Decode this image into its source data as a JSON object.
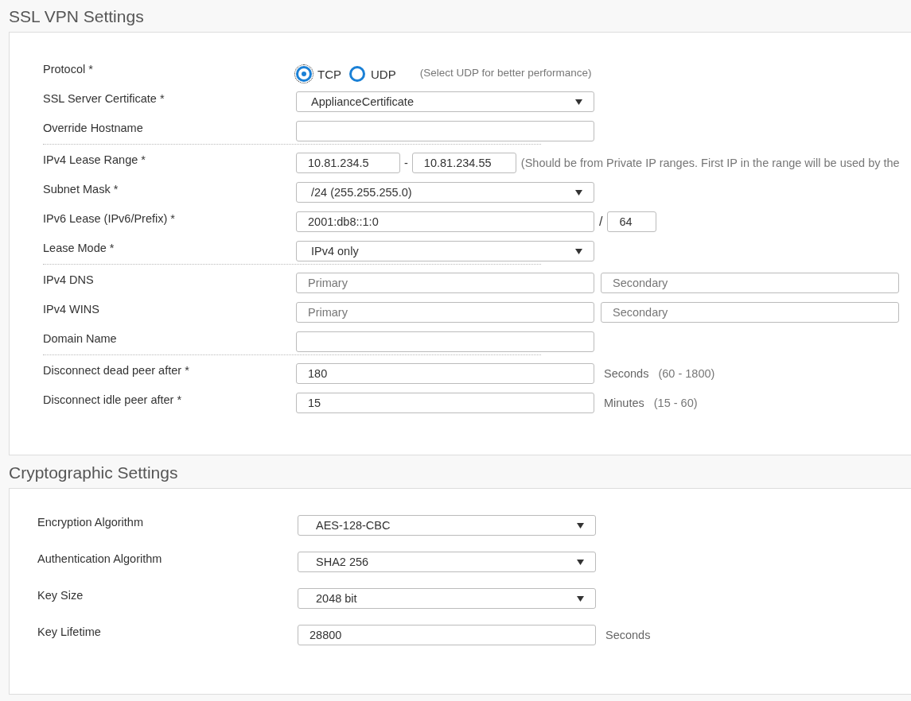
{
  "sections": [
    {
      "title": "SSL VPN Settings",
      "groups": [
        [
          {
            "kind": "radio",
            "label": "Protocol *",
            "options": [
              {
                "label": "TCP",
                "selected": true
              },
              {
                "label": "UDP",
                "selected": false
              }
            ],
            "hint": "(Select UDP for better performance)"
          },
          {
            "kind": "select",
            "label": "SSL Server Certificate *",
            "value": "ApplianceCertificate"
          },
          {
            "kind": "input",
            "label": "Override Hostname"
          }
        ],
        [
          {
            "kind": "range",
            "label": "IPv4 Lease Range *",
            "from": "10.81.234.5",
            "separator": "-",
            "to": "10.81.234.55",
            "hint": "(Should be from Private IP ranges. First IP in the range will be used by the"
          },
          {
            "kind": "select",
            "label": "Subnet Mask *",
            "value": "/24 (255.255.255.0)"
          },
          {
            "kind": "prefix",
            "label": "IPv6 Lease (IPv6/Prefix) *",
            "value": "2001:db8::1:0",
            "separator": "/",
            "prefix": "64"
          },
          {
            "kind": "select",
            "label": "Lease Mode *",
            "value": "IPv4 only"
          }
        ],
        [
          {
            "kind": "pair",
            "label": "IPv4 DNS",
            "fields": [
              {
                "placeholder": "Primary"
              },
              {
                "placeholder": "Secondary"
              }
            ]
          },
          {
            "kind": "pair",
            "label": "IPv4 WINS",
            "fields": [
              {
                "placeholder": "Primary"
              },
              {
                "placeholder": "Secondary"
              }
            ]
          },
          {
            "kind": "input",
            "label": "Domain Name"
          }
        ],
        [
          {
            "kind": "input",
            "label": "Disconnect dead peer after *",
            "value": "180",
            "unit": "Seconds",
            "hint": "(60 - 1800)"
          },
          {
            "kind": "input",
            "label": "Disconnect idle peer after *",
            "value": "15",
            "unit": "Minutes",
            "hint": "(15 - 60)"
          }
        ]
      ]
    },
    {
      "title": "Cryptographic Settings",
      "groups": [
        [
          {
            "kind": "select",
            "label": "Encryption Algorithm",
            "value": "AES-128-CBC"
          },
          {
            "kind": "select",
            "label": "Authentication Algorithm",
            "value": "SHA2 256"
          },
          {
            "kind": "select",
            "label": "Key Size",
            "value": "2048 bit"
          },
          {
            "kind": "input",
            "label": "Key Lifetime",
            "value": "28800",
            "unit": "Seconds"
          }
        ]
      ]
    }
  ]
}
